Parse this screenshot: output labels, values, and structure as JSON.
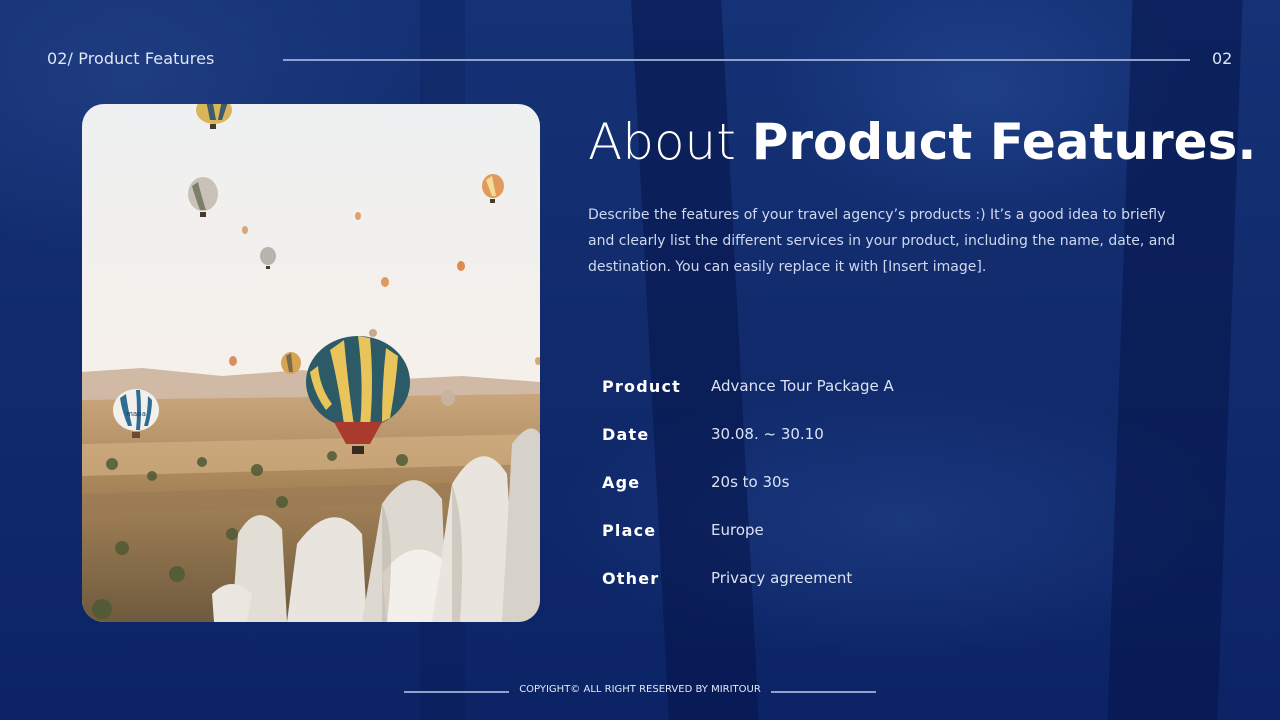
{
  "header": {
    "section_label": "02/ Product Features",
    "page_number": "02"
  },
  "headline": {
    "light": "About",
    "bold": "Product Features."
  },
  "description": "Describe the features of your travel agency’s products :) It’s a good idea to briefly and clearly list the different services in your product, including the name, date, and destination. You can easily replace it with [Insert image].",
  "specs": [
    {
      "label": "Product",
      "value": "Advance Tour Package A"
    },
    {
      "label": "Date",
      "value": "30.08. ~ 30.10"
    },
    {
      "label": "Age",
      "value": "20s to 30s"
    },
    {
      "label": "Place",
      "value": "Europe"
    },
    {
      "label": "Other",
      "value": "Privacy agreement"
    }
  ],
  "photo": {
    "balloon_text": "mapa"
  },
  "footer": {
    "copyright": "COPYIGHT© ALL RIGHT RESERVED BY MIRITOUR"
  },
  "colors": {
    "background": "#0e2770",
    "accent_line": "#8fa2cc",
    "text": "#ffffff"
  }
}
